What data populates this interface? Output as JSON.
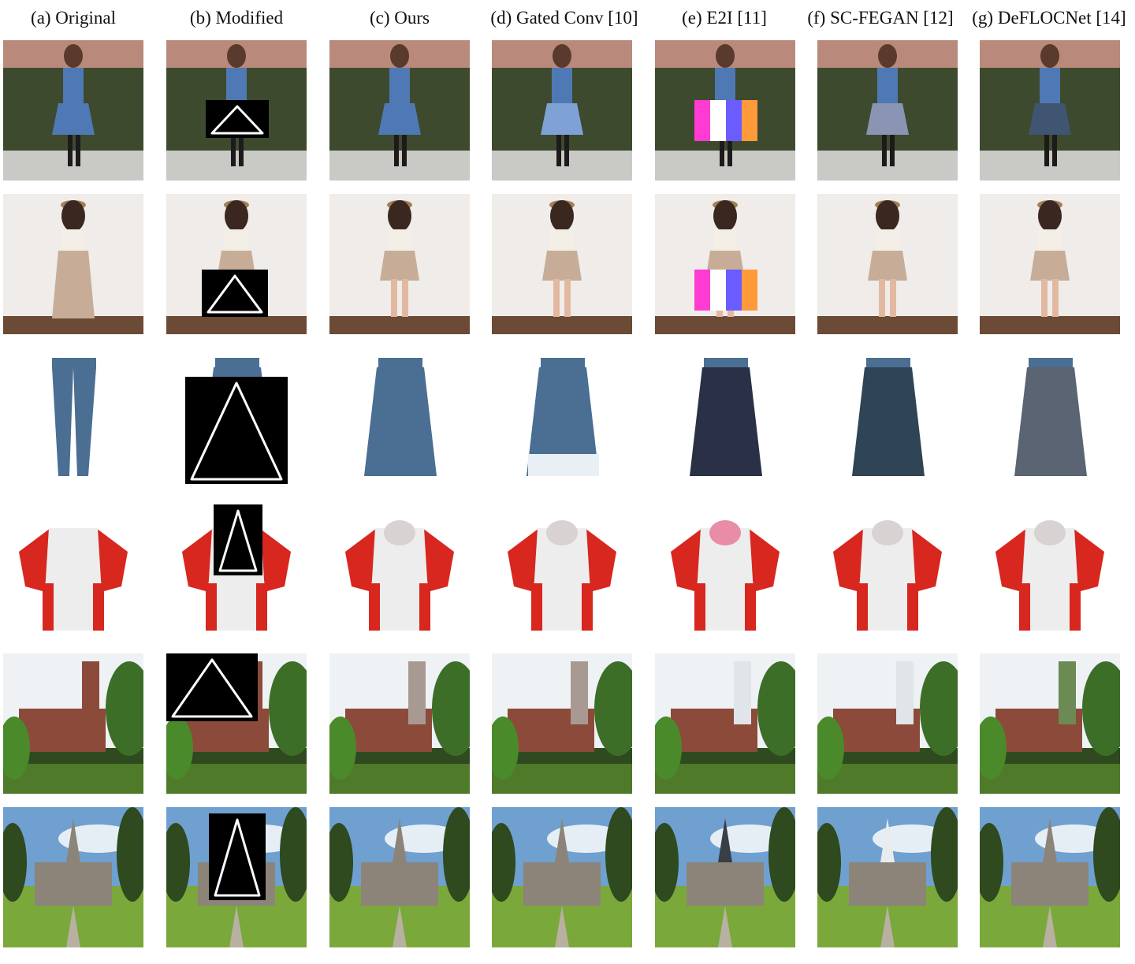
{
  "columns": [
    "(a) Original",
    "(b) Modified",
    "(c) Ours",
    "(d) Gated Conv [10]",
    "(e) E2I [11]",
    "(f) SC-FEGAN [12]",
    "(g) DeFLOCNet [14]"
  ],
  "rows": [
    {
      "subject": "woman-denim-overalls-ivy",
      "colors": {
        "bg": "#3e4a2e",
        "top": "#b98a7c",
        "wear": "#4f79b4",
        "ground": "#c9c9c6"
      }
    },
    {
      "subject": "woman-beige-skirt-hat",
      "colors": {
        "bg": "#efece9",
        "top": "#efece9",
        "wear": "#c7ad97",
        "ground": "#6b4a36"
      }
    },
    {
      "subject": "jeans-to-skirt",
      "colors": {
        "bg": "#ffffff",
        "top": "#ffffff",
        "wear": "#4b6e93",
        "ground": "#ffffff"
      }
    },
    {
      "subject": "red-white-tshirt-hoodie",
      "colors": {
        "bg": "#ffffff",
        "top": "#ffffff",
        "wear": "#d7271f",
        "ground": "#ffffff"
      }
    },
    {
      "subject": "brick-church-tower-trees",
      "colors": {
        "bg": "#eef2f4",
        "top": "#eef2f4",
        "wear": "#8c4a3a",
        "ground": "#2f4a1f"
      }
    },
    {
      "subject": "stone-church-spire",
      "colors": {
        "bg": "#6fa0d0",
        "top": "#e6eef5",
        "wear": "#8c8478",
        "ground": "#7aa83a"
      }
    }
  ],
  "artifacts": {
    "mask": "#000000",
    "sketch": "#ffffff",
    "e2i_glitch": [
      "#ff3bd2",
      "#ffffff",
      "#6b5cff",
      "#ff9a3a"
    ],
    "ours_fill": "#4f79b4"
  }
}
